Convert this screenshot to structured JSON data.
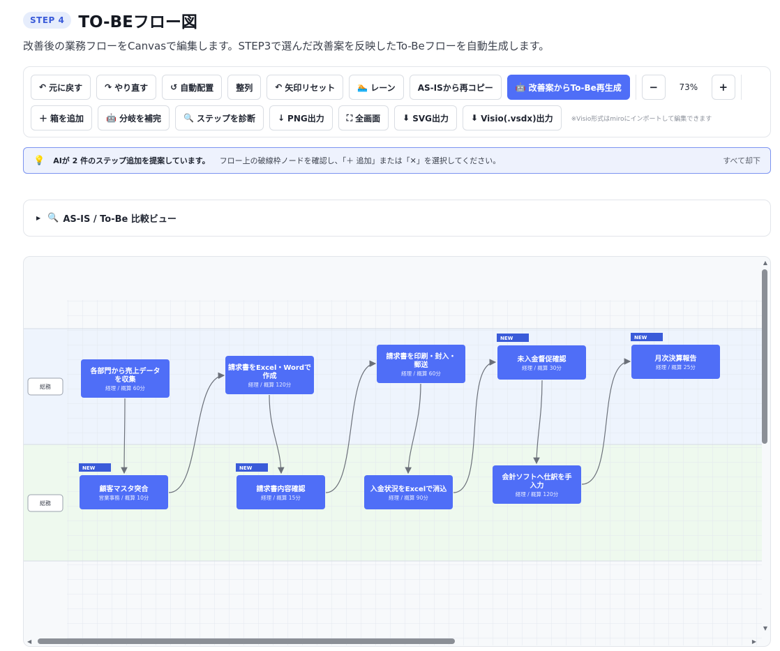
{
  "header": {
    "step_badge": "STEP 4",
    "title": "TO-BEフロー図",
    "description": "改善後の業務フローをCanvasで編集します。STEP3で選んだ改善案を反映したTo-Beフローを自動生成します。"
  },
  "toolbar": {
    "undo": "元に戻す",
    "redo": "やり直す",
    "auto_layout": "自動配置",
    "align": "整列",
    "arrow_reset": "矢印リセット",
    "lane": "レーン",
    "recopy_asis": "AS-ISから再コピー",
    "regenerate": "改善案からTo-Be再生成",
    "zoom_out": "−",
    "zoom_value": "73%",
    "zoom_in": "+",
    "add_box": "箱を追加",
    "complete_branch": "分岐を補完",
    "diagnose": "ステップを診断",
    "png_export": "PNG出力",
    "fullscreen": "全画面",
    "svg_export": "SVG出力",
    "visio_export": "Visio(.vsdx)出力",
    "visio_note": "※Visio形式はmiroにインポートして編集できます"
  },
  "banner": {
    "strong": "AIが 2 件のステップ追加を提案しています。",
    "message": "フロー上の破線枠ノードを確認し、「＋ 追加」または「✕」を選択してください。",
    "dismiss_all": "すべて却下"
  },
  "compare": {
    "label": "AS-IS / To-Be 比較ビュー"
  },
  "canvas": {
    "lanes": [
      {
        "label": "総務",
        "color": "#eef4fd"
      },
      {
        "label": "総務",
        "color": "#eef9ee"
      },
      {
        "label": "",
        "color": "#f7f9fb"
      }
    ],
    "new_badge": "NEW",
    "node_color": "#4f6ef7",
    "nodes": [
      {
        "id": "n1",
        "lines": [
          "各部門から売上データ",
          "を収集"
        ],
        "sub": "経理 / 概算 60分",
        "is_new": false
      },
      {
        "id": "n2",
        "lines": [
          "顧客マスタ突合"
        ],
        "sub": "営業事務 / 概算 10分",
        "is_new": true
      },
      {
        "id": "n3",
        "lines": [
          "請求書をExcel・Wordで",
          "作成"
        ],
        "sub": "経理 / 概算 120分",
        "is_new": false
      },
      {
        "id": "n4",
        "lines": [
          "請求書内容確認"
        ],
        "sub": "経理 / 概算 15分",
        "is_new": true
      },
      {
        "id": "n5",
        "lines": [
          "請求書を印刷・封入・",
          "郵送"
        ],
        "sub": "経理 / 概算 60分",
        "is_new": false
      },
      {
        "id": "n6",
        "lines": [
          "入金状況をExcelで消込"
        ],
        "sub": "経理 / 概算 90分",
        "is_new": false
      },
      {
        "id": "n7",
        "lines": [
          "未入金督促確認"
        ],
        "sub": "経理 / 概算 30分",
        "is_new": true
      },
      {
        "id": "n8",
        "lines": [
          "会計ソフトへ仕訳を手",
          "入力"
        ],
        "sub": "経理 / 概算 120分",
        "is_new": false
      },
      {
        "id": "n9",
        "lines": [
          "月次決算報告"
        ],
        "sub": "経理 / 概算 25分",
        "is_new": true
      }
    ]
  }
}
